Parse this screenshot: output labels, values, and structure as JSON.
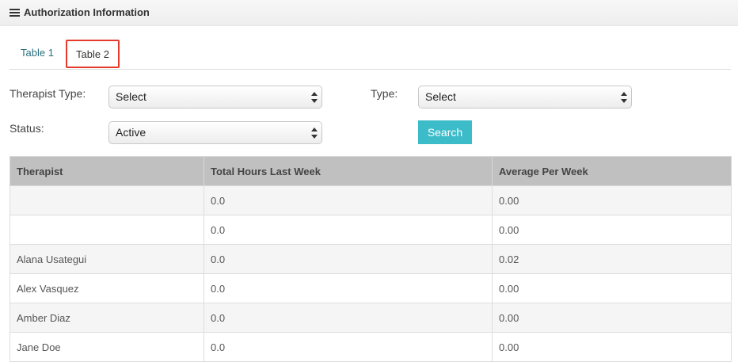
{
  "header": {
    "title": "Authorization Information"
  },
  "tabs": [
    {
      "label": "Table 1"
    },
    {
      "label": "Table 2"
    }
  ],
  "filters": {
    "therapist_type": {
      "label": "Therapist Type:",
      "value": "Select"
    },
    "type": {
      "label": "Type:",
      "value": "Select"
    },
    "status": {
      "label": "Status:",
      "value": "Active"
    },
    "search_label": "Search"
  },
  "table": {
    "columns": [
      "Therapist",
      "Total Hours Last Week",
      "Average Per Week"
    ],
    "rows": [
      [
        "",
        "0.0",
        "0.00"
      ],
      [
        "",
        "0.0",
        "0.00"
      ],
      [
        "Alana Usategui",
        "0.0",
        "0.02"
      ],
      [
        "Alex Vasquez",
        "0.0",
        "0.00"
      ],
      [
        "Amber Diaz",
        "0.0",
        "0.00"
      ],
      [
        "Jane Doe",
        "0.0",
        "0.00"
      ]
    ]
  },
  "colors": {
    "accent": "#3cbcc9",
    "highlight": "#e53a2c",
    "tab_link": "#2a7080"
  },
  "icons": {
    "header": "menu-icon",
    "select": "select-arrows-icon"
  }
}
